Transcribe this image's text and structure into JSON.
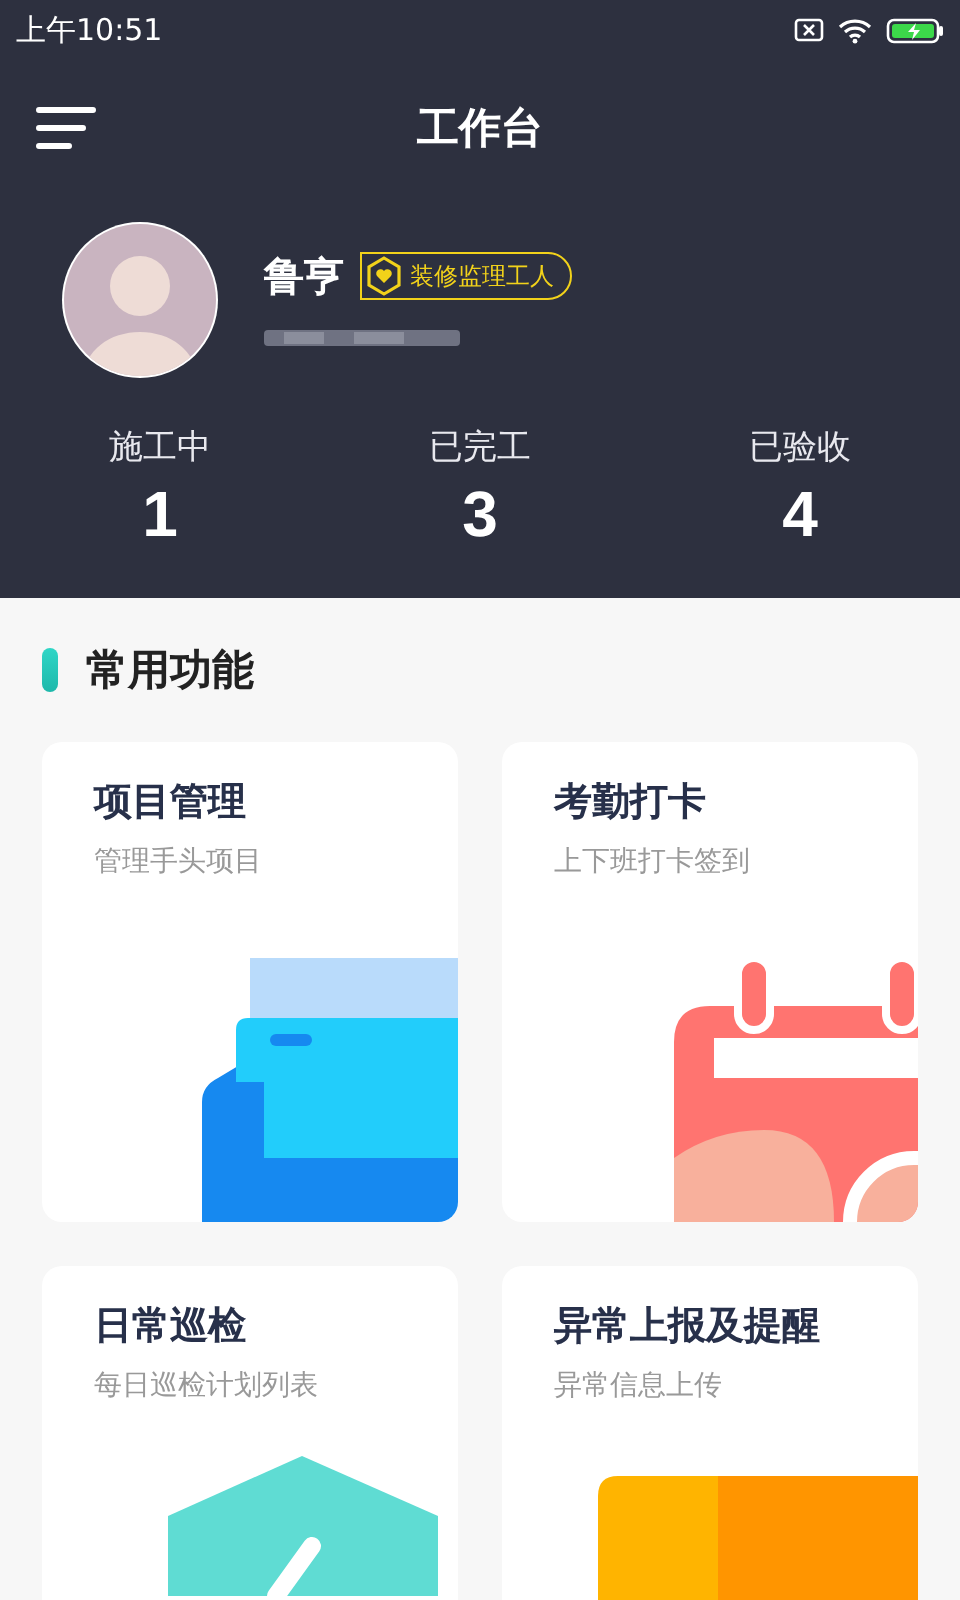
{
  "status_bar": {
    "time": "上午10:51"
  },
  "header": {
    "title": "工作台"
  },
  "profile": {
    "name": "鲁亨",
    "role_badge": "装修监理工人"
  },
  "stats": [
    {
      "label": "施工中",
      "value": "1"
    },
    {
      "label": "已完工",
      "value": "3"
    },
    {
      "label": "已验收",
      "value": "4"
    }
  ],
  "section": {
    "title": "常用功能"
  },
  "features": [
    {
      "title": "项目管理",
      "subtitle": "管理手头项目",
      "kind": "folder"
    },
    {
      "title": "考勤打卡",
      "subtitle": "上下班打卡签到",
      "kind": "calendar"
    },
    {
      "title": "日常巡检",
      "subtitle": "每日巡检计划列表",
      "kind": "shield"
    },
    {
      "title": "异常上报及提醒",
      "subtitle": "异常信息上传",
      "kind": "warning"
    }
  ]
}
